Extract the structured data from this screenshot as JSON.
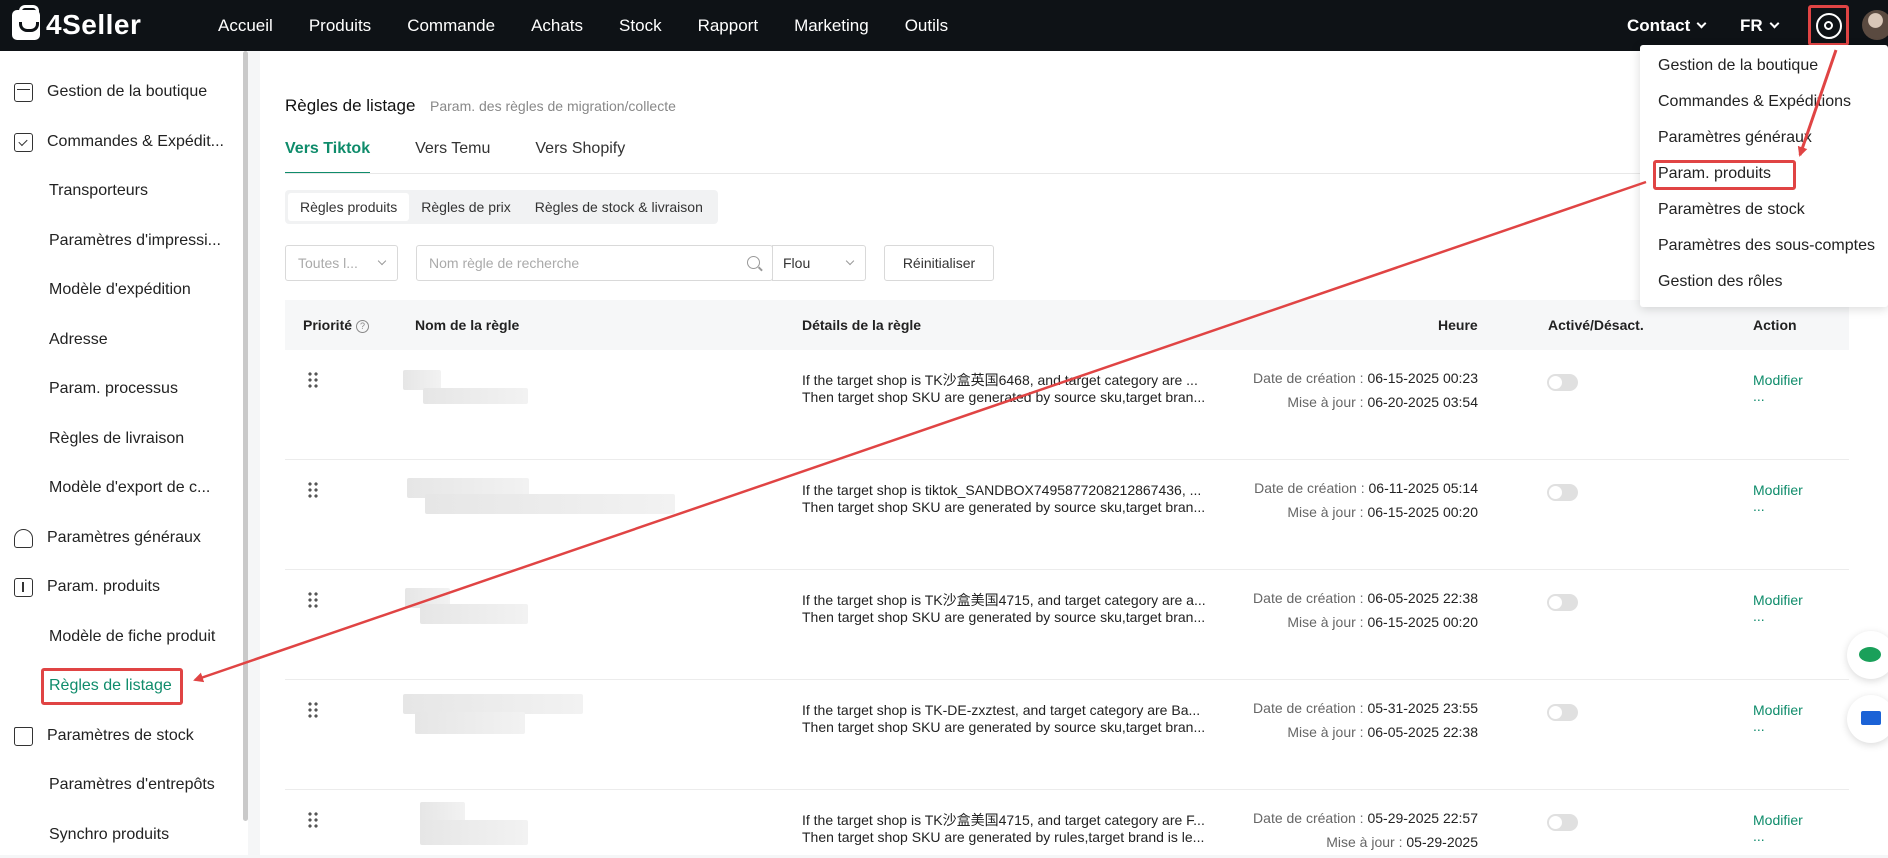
{
  "topbar": {
    "logo_text": "4Seller",
    "nav": [
      "Accueil",
      "Produits",
      "Commande",
      "Achats",
      "Stock",
      "Rapport",
      "Marketing",
      "Outils"
    ],
    "contact_label": "Contact",
    "lang_label": "FR"
  },
  "sidebar": {
    "items": [
      {
        "label": "Gestion de la boutique",
        "level": "top",
        "icon": "shop-icon"
      },
      {
        "label": "Commandes & Expédit...",
        "level": "top",
        "icon": "order-icon"
      },
      {
        "label": "Transporteurs",
        "level": "sub"
      },
      {
        "label": "Paramètres d'impressi...",
        "level": "sub"
      },
      {
        "label": "Modèle d'expédition",
        "level": "sub"
      },
      {
        "label": "Adresse",
        "level": "sub"
      },
      {
        "label": "Param. processus",
        "level": "sub"
      },
      {
        "label": "Règles de livraison",
        "level": "sub"
      },
      {
        "label": "Modèle d'export de c...",
        "level": "sub"
      },
      {
        "label": "Paramètres généraux",
        "level": "top",
        "icon": "general-settings-icon"
      },
      {
        "label": "Param. produits",
        "level": "top",
        "icon": "product-settings-icon"
      },
      {
        "label": "Modèle de fiche produit",
        "level": "sub"
      },
      {
        "label": "Règles de listage",
        "level": "sub",
        "active": true
      },
      {
        "label": "Paramètres de stock",
        "level": "top",
        "icon": "stock-icon"
      },
      {
        "label": "Paramètres d'entrepôts",
        "level": "sub"
      },
      {
        "label": "Synchro produits",
        "level": "sub"
      }
    ]
  },
  "page": {
    "title": "Règles de listage",
    "subtitle": "Param. des règles de migration/collecte",
    "tabs": [
      "Vers Tiktok",
      "Vers Temu",
      "Vers Shopify"
    ],
    "segments": [
      "Règles produits",
      "Règles de prix",
      "Règles de stock & livraison"
    ]
  },
  "filters": {
    "shop_select": "Toutes l...",
    "search_placeholder": "Nom règle de recherche",
    "match_mode": "Flou",
    "reset_label": "Réinitialiser"
  },
  "table": {
    "headers": {
      "priority": "Priorité",
      "name": "Nom de la règle",
      "details": "Détails de la règle",
      "time": "Heure",
      "enabled": "Activé/Désact.",
      "action": "Action"
    },
    "created_label": "Date de création :",
    "updated_label": "Mise à jour :",
    "edit_label": "Modifier",
    "more_label": "...",
    "rows": [
      {
        "detail1": "If the target shop is TK沙盒英国6468, and target category are ...",
        "detail2": "Then target shop SKU are generated by source sku,target bran...",
        "created": "06-15-2025 00:23",
        "updated": "06-20-2025 03:54",
        "enabled": false
      },
      {
        "detail1": "If the target shop is tiktok_SANDBOX7495877208212867436, ...",
        "detail2": "Then target shop SKU are generated by source sku,target bran...",
        "created": "06-11-2025 05:14",
        "updated": "06-15-2025 00:20",
        "enabled": false
      },
      {
        "detail1": "If the target shop is TK沙盒美国4715, and target category are a...",
        "detail2": "Then target shop SKU are generated by source sku,target bran...",
        "created": "06-05-2025 22:38",
        "updated": "06-15-2025 00:20",
        "enabled": false
      },
      {
        "detail1": "If the target shop is TK-DE-zxztest, and target category are Ba...",
        "detail2": "Then target shop SKU are generated by source sku,target bran...",
        "created": "05-31-2025 23:55",
        "updated": "06-05-2025 22:38",
        "enabled": false
      },
      {
        "detail1": "If the target shop is TK沙盒美国4715, and target category are F...",
        "detail2": "Then target shop SKU are generated by rules,target brand is le...",
        "created": "05-29-2025 22:57",
        "updated": "05-29-2025",
        "enabled": false
      }
    ]
  },
  "dropdown": {
    "items": [
      "Gestion de la boutique",
      "Commandes & Expéditions",
      "Paramètres généraux",
      "Param. produits",
      "Paramètres de stock",
      "Paramètres des sous-comptes",
      "Gestion des rôles"
    ]
  },
  "colors": {
    "accent": "#0f8c6b",
    "annotation": "#e04444",
    "topbar": "#0e1216"
  }
}
